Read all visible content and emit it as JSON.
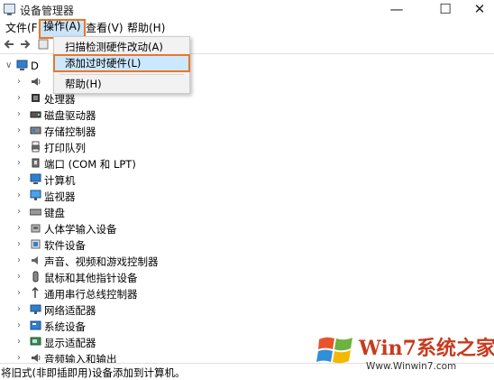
{
  "window": {
    "title": "设备管理器",
    "minimize": "—",
    "maximize": "☐",
    "close": "✕"
  },
  "menubar": {
    "items": [
      "文件(F)",
      "操作(A)",
      "查看(V)",
      "帮助(H)"
    ],
    "active_index": 1
  },
  "root_label": "D",
  "dropdown": {
    "items": [
      "扫描检测硬件改动(A)",
      "添加过时硬件(L)",
      "帮助(H)"
    ],
    "highlighted_index": 1
  },
  "tree": {
    "items": [
      {
        "label": "",
        "icon": "audio-io-icon"
      },
      {
        "label": "处理器",
        "icon": "cpu-icon"
      },
      {
        "label": "磁盘驱动器",
        "icon": "disk-icon"
      },
      {
        "label": "存储控制器",
        "icon": "storage-controller-icon"
      },
      {
        "label": "打印队列",
        "icon": "printer-icon"
      },
      {
        "label": "端口 (COM 和 LPT)",
        "icon": "port-icon"
      },
      {
        "label": "计算机",
        "icon": "computer-icon"
      },
      {
        "label": "监视器",
        "icon": "monitor-icon"
      },
      {
        "label": "键盘",
        "icon": "keyboard-icon"
      },
      {
        "label": "人体学输入设备",
        "icon": "hid-icon"
      },
      {
        "label": "软件设备",
        "icon": "software-device-icon"
      },
      {
        "label": "声音、视频和游戏控制器",
        "icon": "speaker-icon"
      },
      {
        "label": "鼠标和其他指针设备",
        "icon": "mouse-icon"
      },
      {
        "label": "通用串行总线控制器",
        "icon": "usb-icon"
      },
      {
        "label": "网络适配器",
        "icon": "network-icon"
      },
      {
        "label": "系统设备",
        "icon": "system-device-icon"
      },
      {
        "label": "显示适配器",
        "icon": "display-adapter-icon"
      },
      {
        "label": "音频输入和输出",
        "icon": "audio-io-icon"
      }
    ]
  },
  "status": "将旧式(非即插即用)设备添加到计算机。",
  "watermark": {
    "text": "Win7系统之家",
    "url": "Www.Winwin7.com"
  },
  "colors": {
    "highlight_border": "#e9762b",
    "highlight_fill": "#cce8ff",
    "icon_blue": "#2f7fd0"
  }
}
